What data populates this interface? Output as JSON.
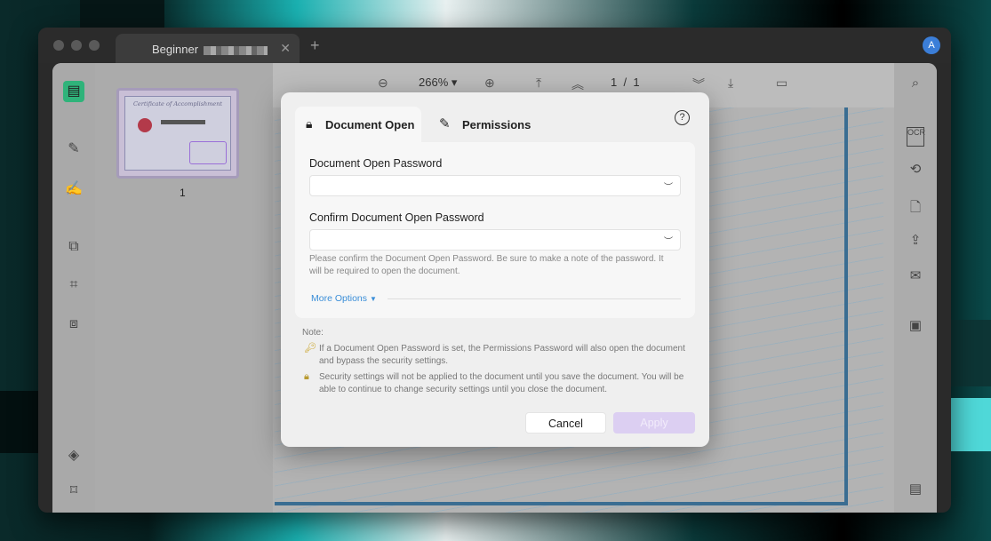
{
  "window": {
    "tab_title": "Beginner",
    "avatar": "A"
  },
  "toolbar": {
    "zoom": "266%",
    "page_current": "1",
    "page_sep": "/",
    "page_total": "1"
  },
  "thumbnails": [
    {
      "label": "1",
      "title": "Certificate of Accomplishment"
    }
  ],
  "dialog": {
    "tabs": [
      {
        "label": "Document Open",
        "icon": "lock-doc-icon"
      },
      {
        "label": "Permissions",
        "icon": "doc-pen-icon"
      }
    ],
    "help_icon": "question-icon",
    "open_password_label": "Document Open Password",
    "open_password_value": "",
    "confirm_password_label": "Confirm Document Open Password",
    "confirm_password_value": "",
    "hint": "Please confirm the Document Open Password. Be sure to make a note of the password. It will be required to open the document.",
    "more_options": "More Options",
    "note_label": "Note:",
    "notes": [
      {
        "icon": "key-icon",
        "text": "If a Document Open Password is set, the Permissions Password will also open the document and bypass the security settings."
      },
      {
        "icon": "padlock-icon",
        "text": "Security settings will not be applied to the document until you save the document. You will be able to continue to change security settings until you close the document."
      }
    ],
    "cancel": "Cancel",
    "apply": "Apply"
  },
  "colors": {
    "accent": "#3a8ed8",
    "apply_disabled": "#dccff2",
    "active_sidebar": "#2fb37a"
  }
}
